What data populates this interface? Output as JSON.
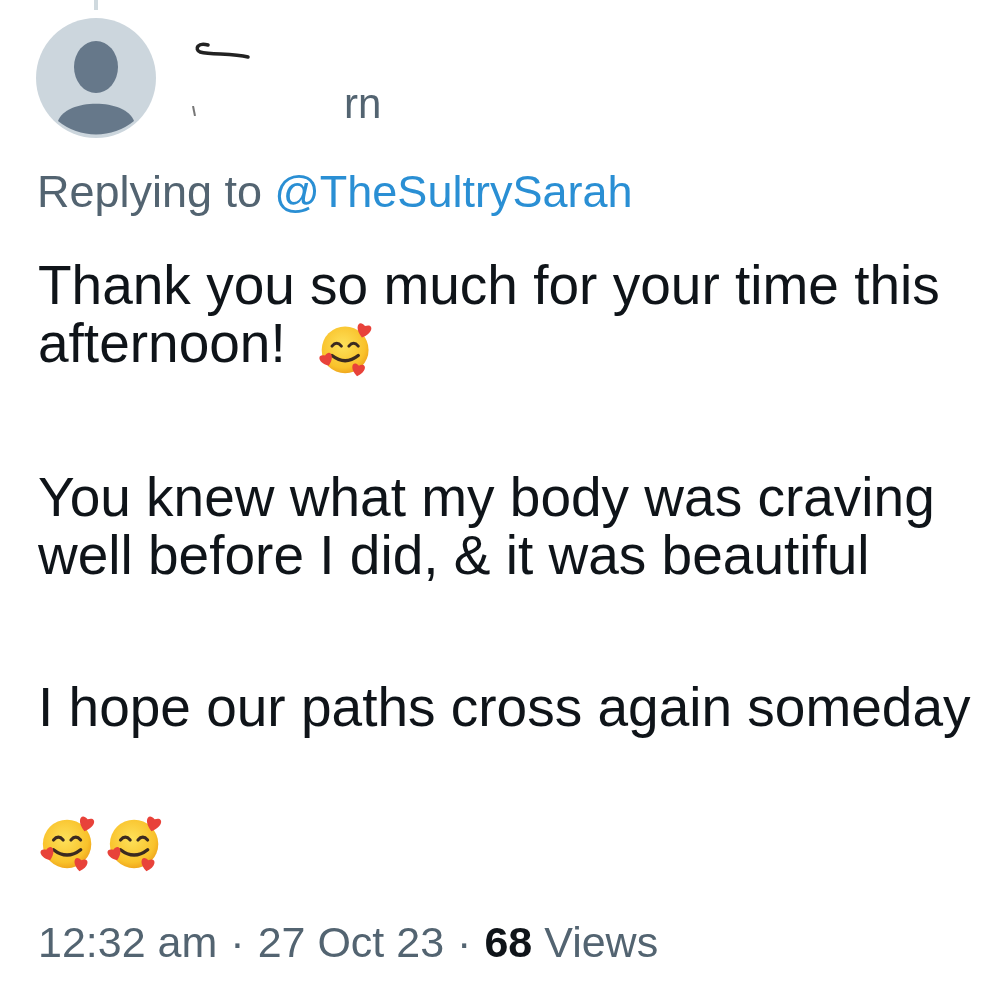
{
  "thread": {
    "connector_above": true
  },
  "author": {
    "name_fragment": "rn"
  },
  "reply_context": {
    "label": "Replying to",
    "handle": "@TheSultrySarah"
  },
  "tweet": {
    "paragraphs": [
      {
        "lines": [
          "Thank you so much for your time this",
          "afternoon!"
        ],
        "emojis": [
          {
            "kind": "smitten"
          }
        ]
      },
      {
        "text": "You knew what my body was craving well before I did, & it was beautiful"
      },
      {
        "text": "I hope our paths cross again someday"
      },
      {
        "emojis": [
          {
            "kind": "smitten"
          },
          {
            "kind": "smitten"
          }
        ]
      }
    ]
  },
  "meta": [
    {
      "kind": "time",
      "text": "12:32 am"
    },
    {
      "kind": "separator",
      "text": "·"
    },
    {
      "kind": "date",
      "text": "27 Oct 23"
    },
    {
      "kind": "separator",
      "text": "·"
    },
    {
      "kind": "views",
      "count": "68",
      "label": "Views"
    }
  ]
}
